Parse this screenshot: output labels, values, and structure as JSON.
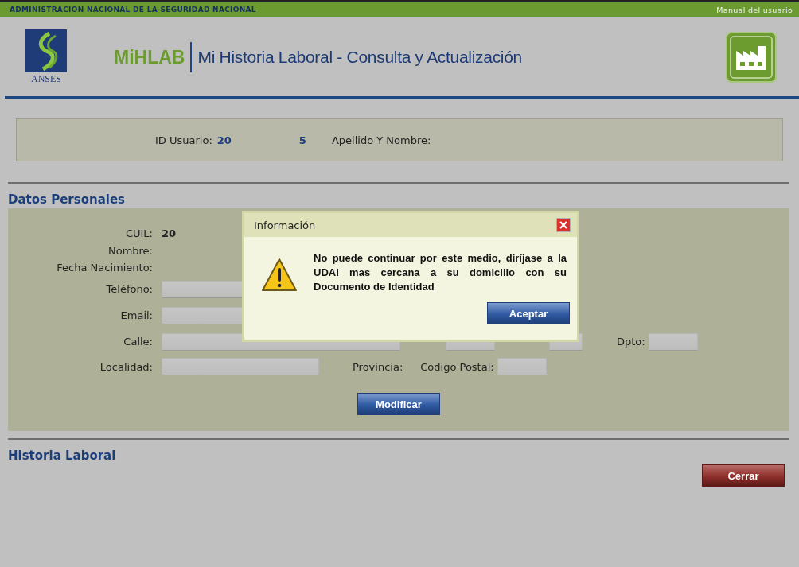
{
  "top_bar": {
    "agency": "ADMINISTRACION NACIONAL DE LA SEGURIDAD NACIONAL",
    "manual_link": "Manual del usuario"
  },
  "header": {
    "logo_text": "ANSES",
    "app_name": "MiHLAB",
    "title": "Mi Historia Laboral - Consulta y Actualización"
  },
  "user_info": {
    "id_label": "ID Usuario:",
    "id_value_1": "20",
    "id_value_2": "5",
    "name_label": "Apellido Y Nombre:"
  },
  "personal_data": {
    "heading": "Datos Personales",
    "rows": [
      {
        "kind": "value",
        "label": "CUIL:",
        "value": "20"
      },
      {
        "kind": "value",
        "label": "Nombre:"
      },
      {
        "kind": "value",
        "label": "Fecha Nacimiento:"
      },
      {
        "kind": "input",
        "label": "Teléfono:"
      },
      {
        "kind": "input",
        "label": "Email:"
      },
      {
        "kind": "address",
        "label": "Calle:",
        "extra_label": "Dpto:"
      },
      {
        "kind": "locality",
        "label": "Localidad:",
        "province_label": "Provincia:",
        "postal_label": "Codigo Postal:"
      }
    ],
    "modify_button": "Modificar"
  },
  "work_history": {
    "heading": "Historia Laboral",
    "close_button": "Cerrar"
  },
  "dialog": {
    "title": "Información",
    "message": "No puede continuar por este medio, diríjase a la UDAI mas cercana a su domicilio con su Documento de Identidad",
    "button": "Aceptar"
  }
}
